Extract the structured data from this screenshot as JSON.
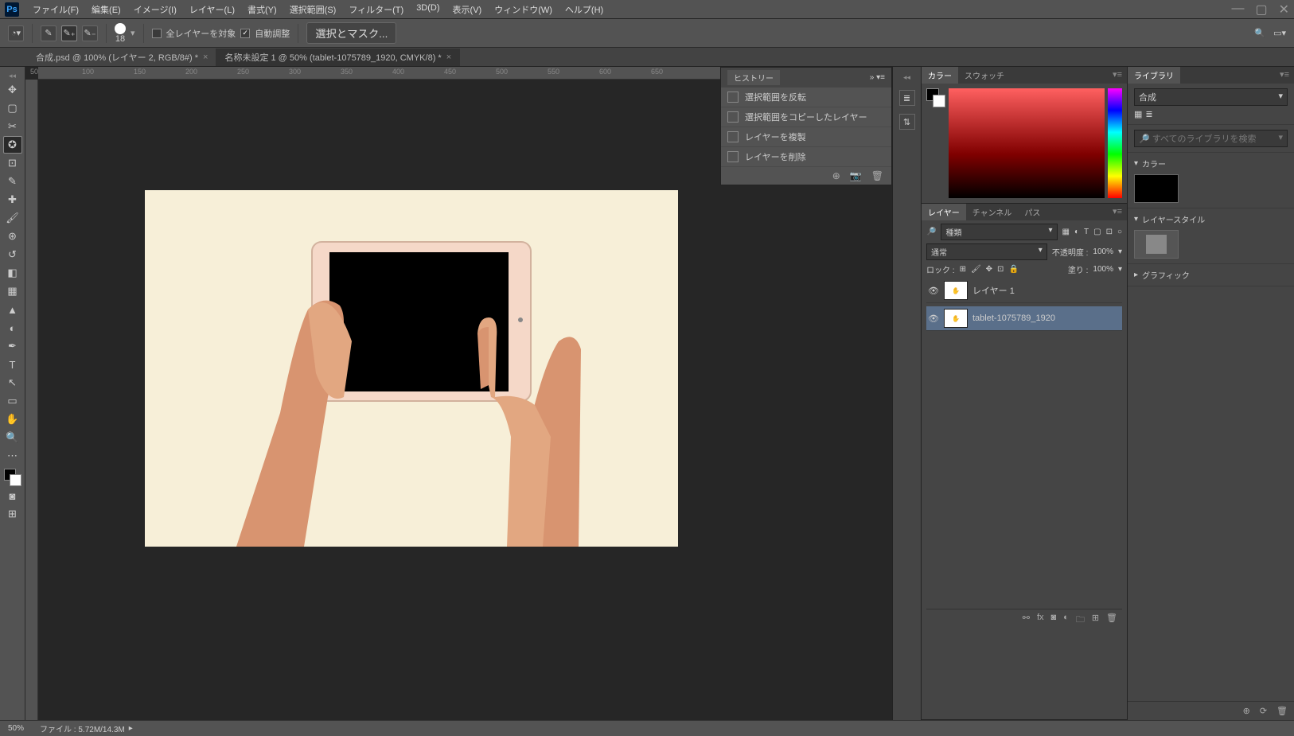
{
  "menu": {
    "items": [
      "ファイル(F)",
      "編集(E)",
      "イメージ(I)",
      "レイヤー(L)",
      "書式(Y)",
      "選択範囲(S)",
      "フィルター(T)",
      "3D(D)",
      "表示(V)",
      "ウィンドウ(W)",
      "ヘルプ(H)"
    ]
  },
  "optionbar": {
    "brush_size": "18",
    "all_layers": "全レイヤーを対象",
    "auto_adjust": "自動調整",
    "select_mask": "選択とマスク..."
  },
  "tabs": [
    {
      "label": "合成.psd @ 100% (レイヤー 2, RGB/8#) *",
      "active": false
    },
    {
      "label": "名称未設定 1 @ 50% (tablet-1075789_1920, CMYK/8) *",
      "active": true
    }
  ],
  "ruler_marks": [
    "50",
    "100",
    "150",
    "200",
    "250",
    "300",
    "350",
    "400",
    "450",
    "500",
    "550",
    "600",
    "650"
  ],
  "history": {
    "title": "ヒストリー",
    "items": [
      "選択範囲を反転",
      "選択範囲をコピーしたレイヤー",
      "レイヤーを複製",
      "レイヤーを削除"
    ]
  },
  "panel_color": {
    "tab_color": "カラー",
    "tab_swatch": "スウォッチ"
  },
  "panel_layers": {
    "tab_layer": "レイヤー",
    "tab_channel": "チャンネル",
    "tab_path": "パス",
    "kind": "種類",
    "blend": "通常",
    "opacity_label": "不透明度 :",
    "opacity_val": "100%",
    "lock_label": "ロック :",
    "fill_label": "塗り :",
    "fill_val": "100%",
    "layers": [
      {
        "name": "レイヤー 1",
        "selected": false
      },
      {
        "name": "tablet-1075789_1920",
        "selected": true
      }
    ]
  },
  "panel_lib": {
    "tab": "ライブラリ",
    "library_name": "合成",
    "search_ph": "すべてのライブラリを検索",
    "sec_color": "カラー",
    "sec_style": "レイヤースタイル",
    "sec_graphic": "グラフィック"
  },
  "status": {
    "zoom": "50%",
    "file": "ファイル : 5.72M/14.3M"
  }
}
